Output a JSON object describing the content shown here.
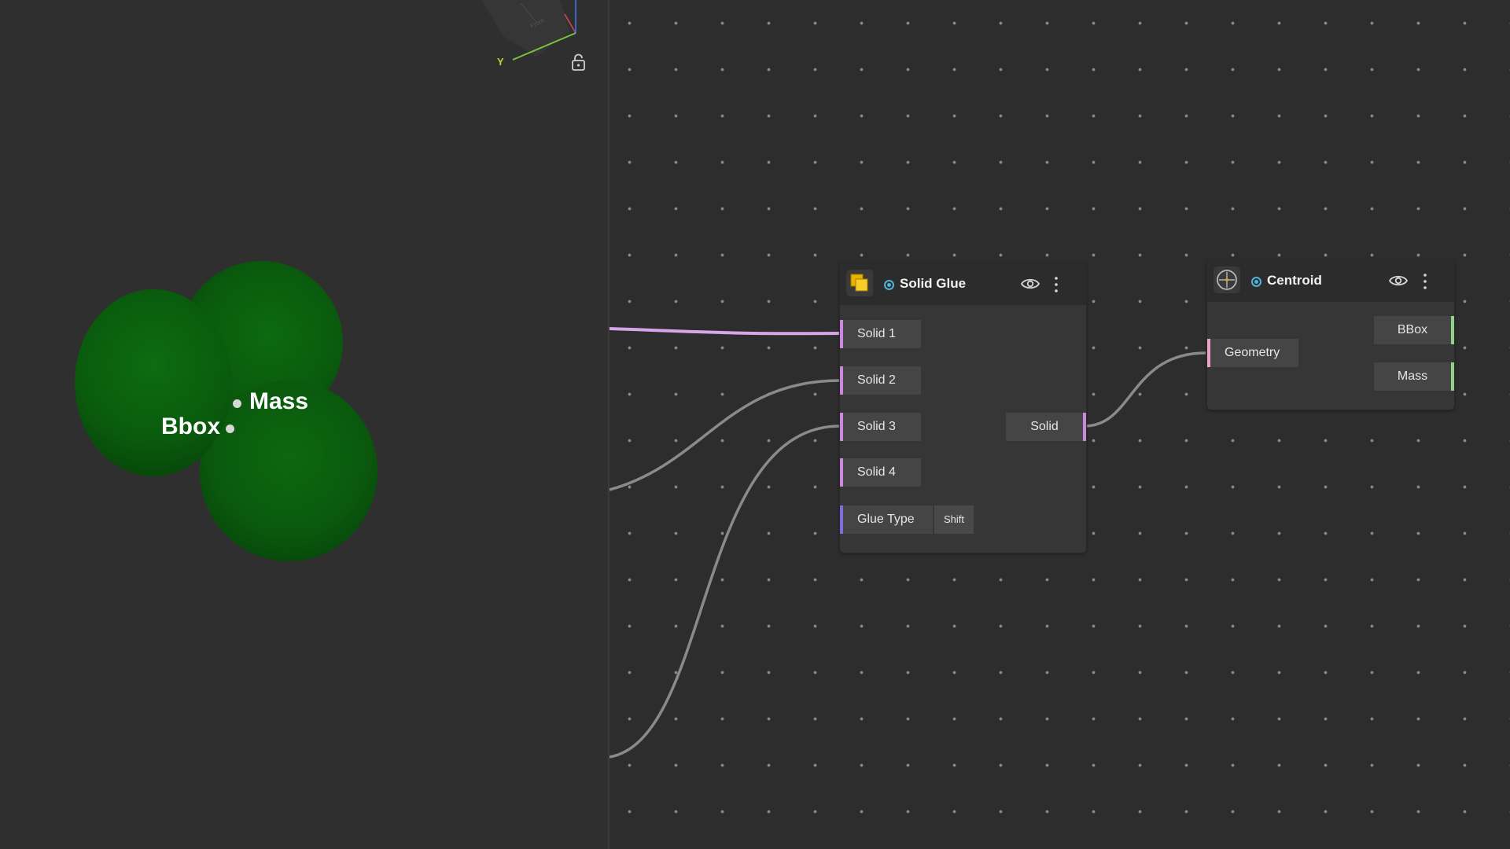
{
  "viewport": {
    "axis_label_y": "Y",
    "axis_face_label": "Front",
    "labels": {
      "mass": "Mass",
      "bbox": "Bbox"
    },
    "sphere_color": "#0a5a0d"
  },
  "graph": {
    "nodes": {
      "solid_glue": {
        "title": "Solid Glue",
        "icon": "solid-glue-icon",
        "inputs": [
          {
            "label": "Solid 1"
          },
          {
            "label": "Solid 2"
          },
          {
            "label": "Solid 3"
          },
          {
            "label": "Solid 4"
          },
          {
            "label": "Glue Type",
            "value": "Shift"
          }
        ],
        "outputs": [
          {
            "label": "Solid"
          }
        ]
      },
      "centroid": {
        "title": "Centroid",
        "icon": "crosshair-icon",
        "inputs": [
          {
            "label": "Geometry"
          }
        ],
        "outputs": [
          {
            "label": "BBox"
          },
          {
            "label": "Mass"
          }
        ]
      }
    },
    "colors": {
      "solid_port": "#c987de",
      "glue_type_port": "#7b6ce0",
      "geometry_port": "#f0a0c8",
      "output_port": "#8fd38a",
      "status": "#4fb3d9",
      "wire": "#8a8a8a",
      "wire_active": "#d8a5e8"
    }
  }
}
